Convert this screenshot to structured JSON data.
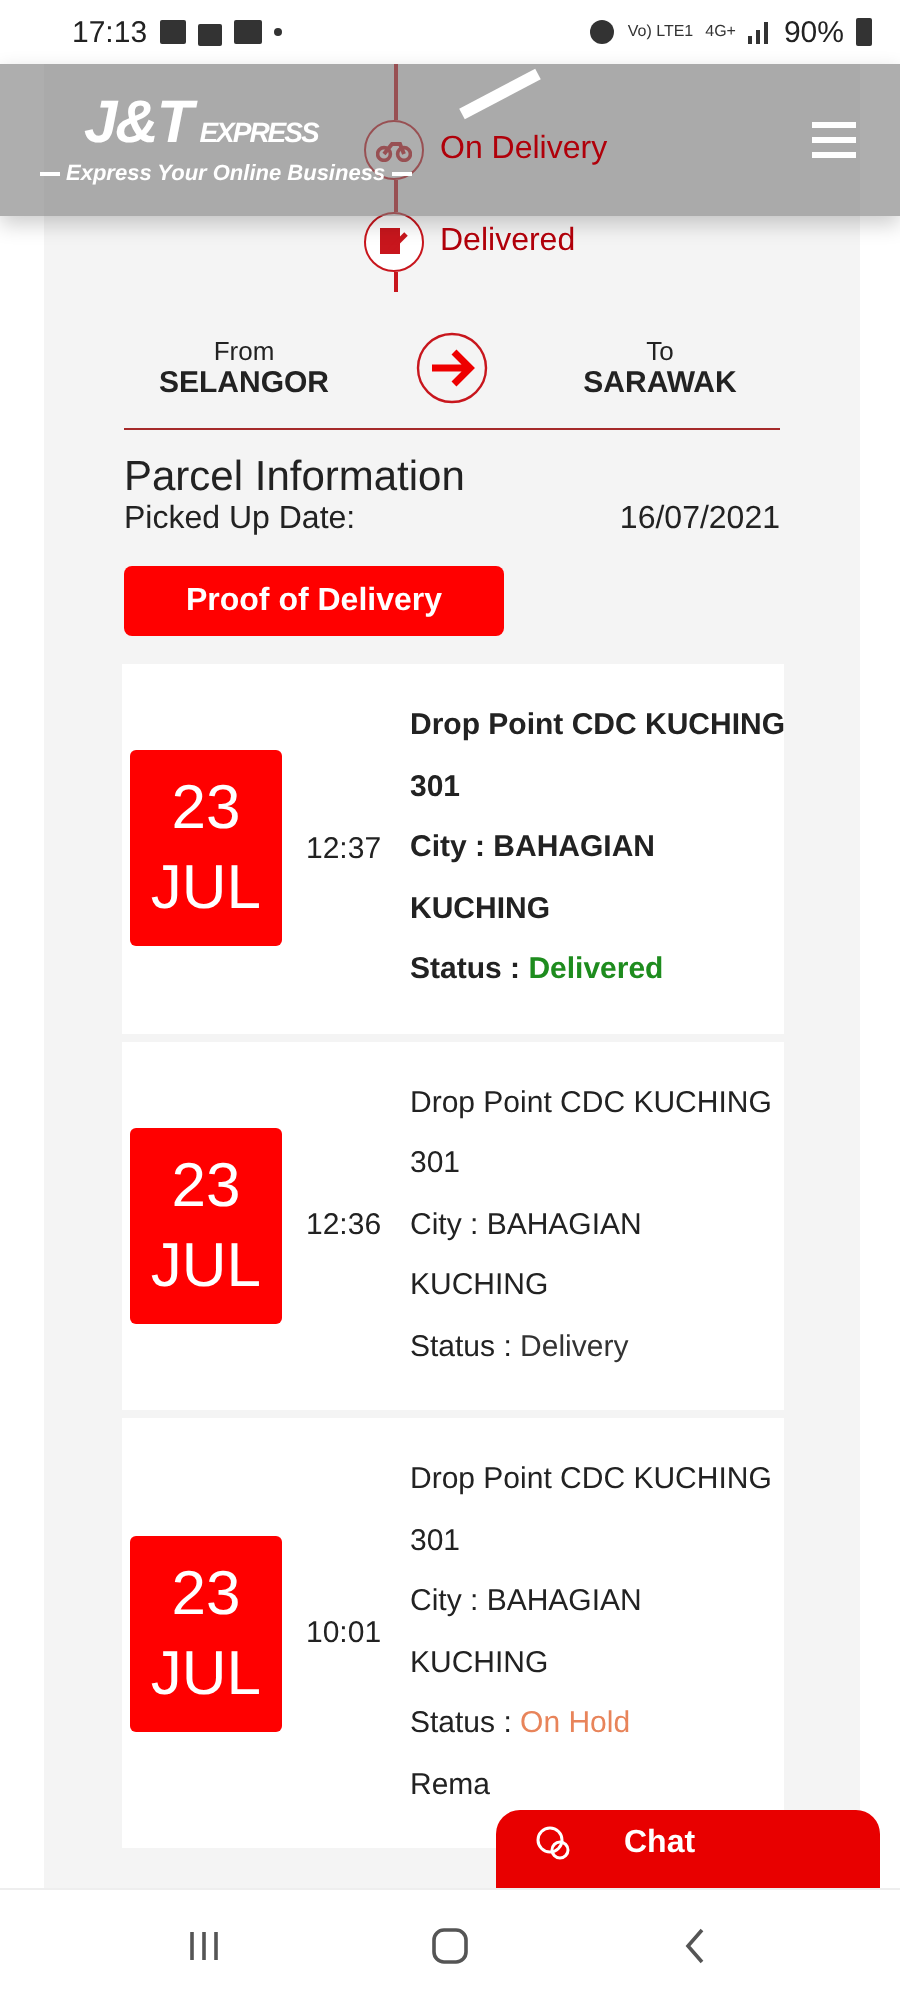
{
  "status_bar": {
    "time": "17:13",
    "network": "Vo) LTE1",
    "data": "4G+",
    "battery": "90%"
  },
  "header": {
    "brand": "J&T",
    "brand_sub": "EXPRESS",
    "tagline": "Express Your Online Business"
  },
  "timeline": [
    {
      "label": "On Delivery",
      "kind": "motorbike"
    },
    {
      "label": "Delivered",
      "kind": "signed"
    }
  ],
  "route": {
    "from_label": "From",
    "from": "SELANGOR",
    "to_label": "To",
    "to": "SARAWAK"
  },
  "parcel": {
    "title": "Parcel Information",
    "picked_label": "Picked Up Date:",
    "picked_date": "16/07/2021",
    "proof_button": "Proof of Delivery"
  },
  "events": [
    {
      "day": "23",
      "month": "JUL",
      "time": "12:37",
      "bold": true,
      "lines": [
        "Drop Point CDC KUCHING",
        "301",
        "City : BAHAGIAN",
        "KUCHING"
      ],
      "status_label": "Status : ",
      "status": "Delivered",
      "color": "#1e8c1e"
    },
    {
      "day": "23",
      "month": "JUL",
      "time": "12:36",
      "bold": false,
      "lines": [
        "Drop Point CDC KUCHING",
        "301",
        "City : BAHAGIAN",
        "KUCHING"
      ],
      "status_label": "Status : ",
      "status": "Delivery",
      "color": "#333333"
    },
    {
      "day": "23",
      "month": "JUL",
      "time": "10:01",
      "bold": false,
      "lines": [
        "Drop Point CDC KUCHING",
        "301",
        "City : BAHAGIAN",
        "KUCHING"
      ],
      "status_label": "Status : ",
      "status": "On Hold",
      "color": "#e8845a",
      "extra": "Rema"
    }
  ],
  "chat_button": "Chat"
}
